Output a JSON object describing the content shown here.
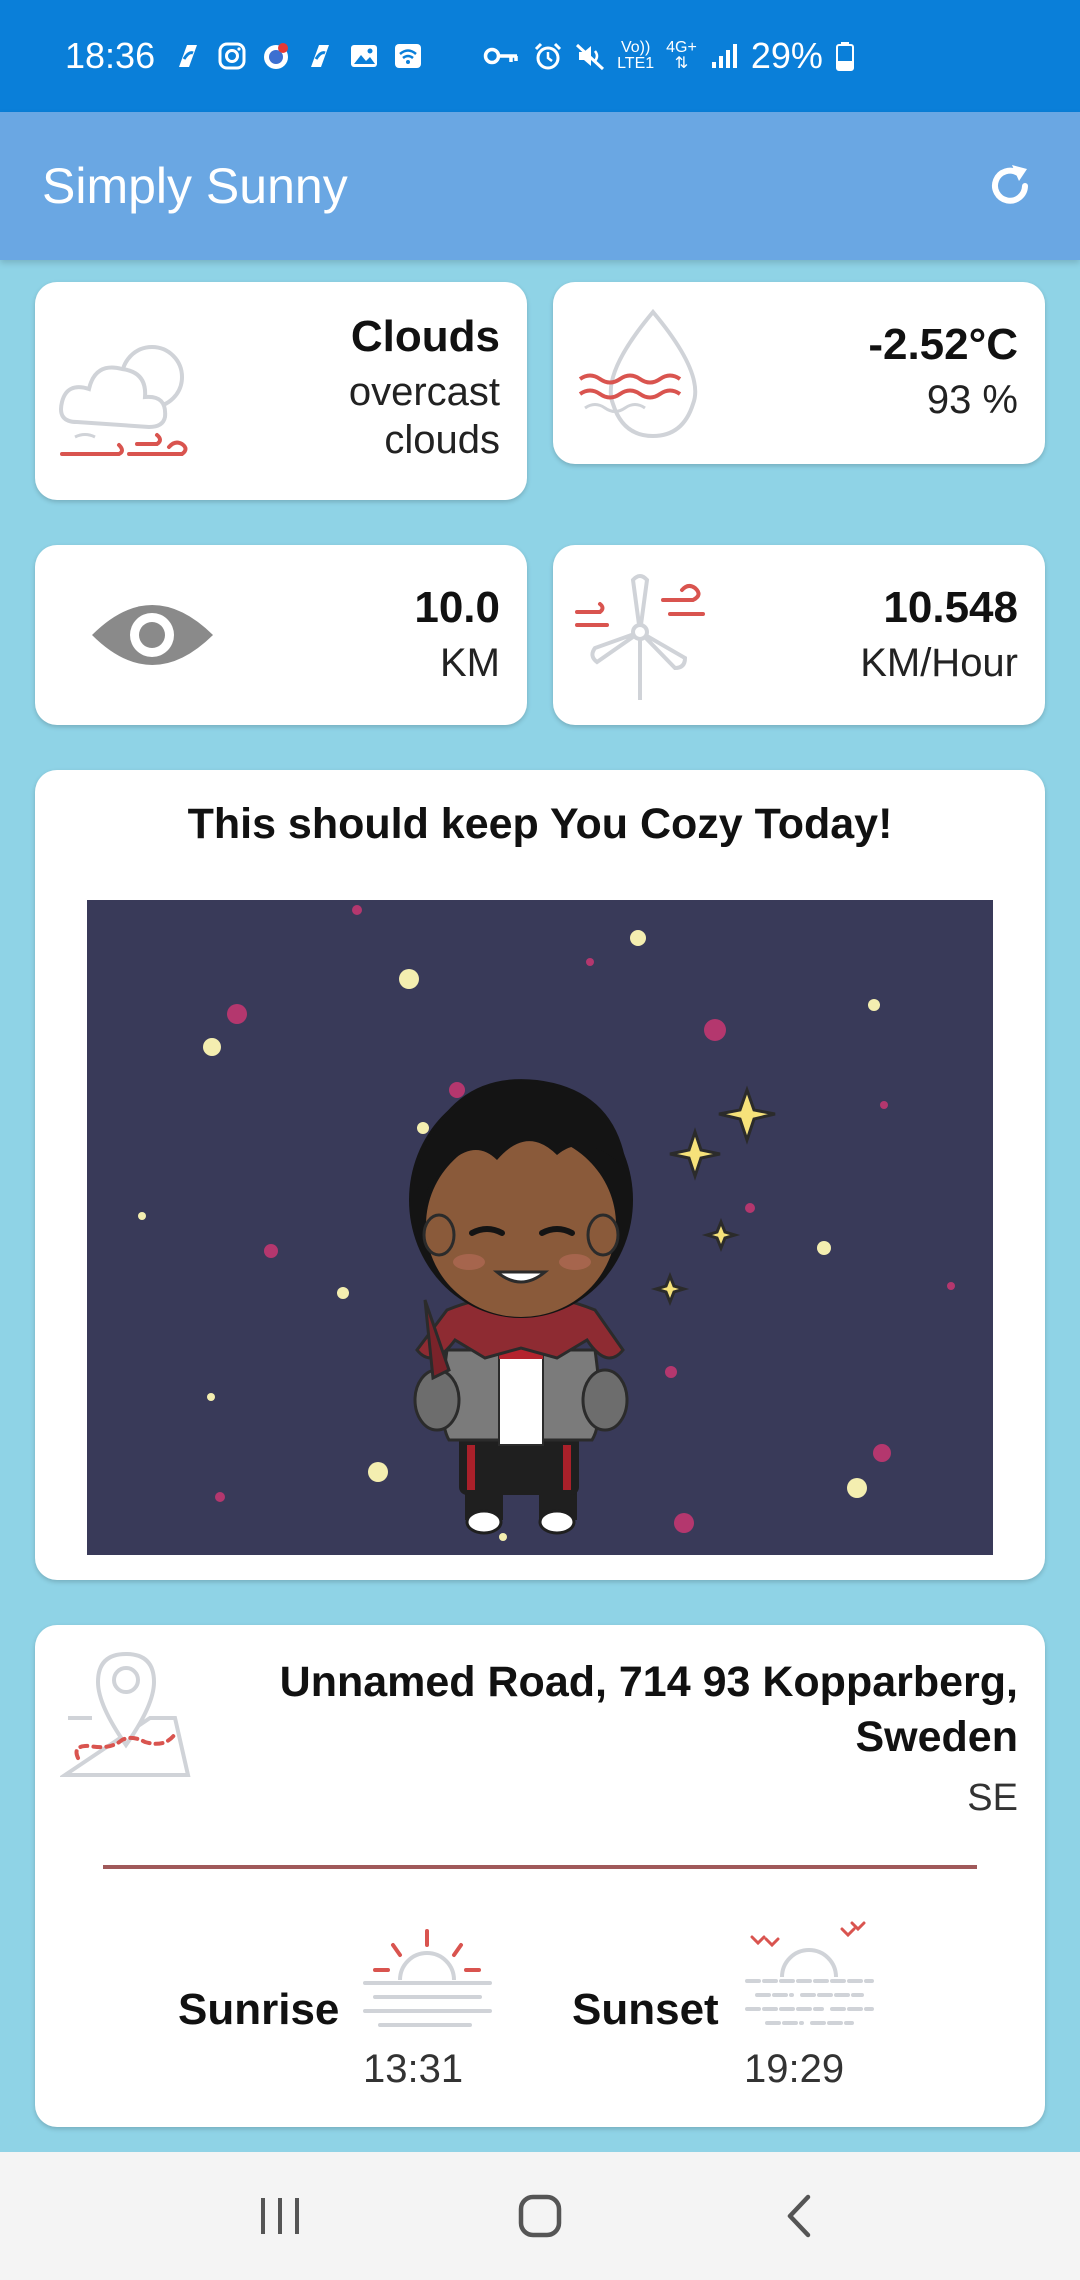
{
  "status_bar": {
    "time": "18:36",
    "volte_top": "Vo))",
    "volte_bottom": "LTE1",
    "network": "4G+",
    "battery": "29%"
  },
  "app_bar": {
    "title": "Simply Sunny",
    "refresh_icon": "refresh-icon"
  },
  "weather": {
    "main": "Clouds",
    "description_line1": "overcast",
    "description_line2": "clouds"
  },
  "temperature": {
    "value": "-2.52°C",
    "humidity": "93 %"
  },
  "visibility": {
    "value": "10.0",
    "unit": "KM"
  },
  "wind": {
    "value": "10.548",
    "unit": "KM/Hour"
  },
  "outfit": {
    "title": "This should keep You Cozy Today!"
  },
  "location": {
    "address_line1": "Unnamed Road, 714 93 Kopparberg,",
    "address_line2": "Sweden",
    "country_code": "SE"
  },
  "sun": {
    "sunrise_label": "Sunrise",
    "sunrise_time": "13:31",
    "sunset_label": "Sunset",
    "sunset_time": "19:29"
  },
  "colors": {
    "status_bar": "#0a7fd9",
    "app_bar": "#6aa7e3",
    "background": "#8fd3e6",
    "accent_red": "#d9544f",
    "divider": "#a0595a",
    "image_bg": "#393a59"
  }
}
